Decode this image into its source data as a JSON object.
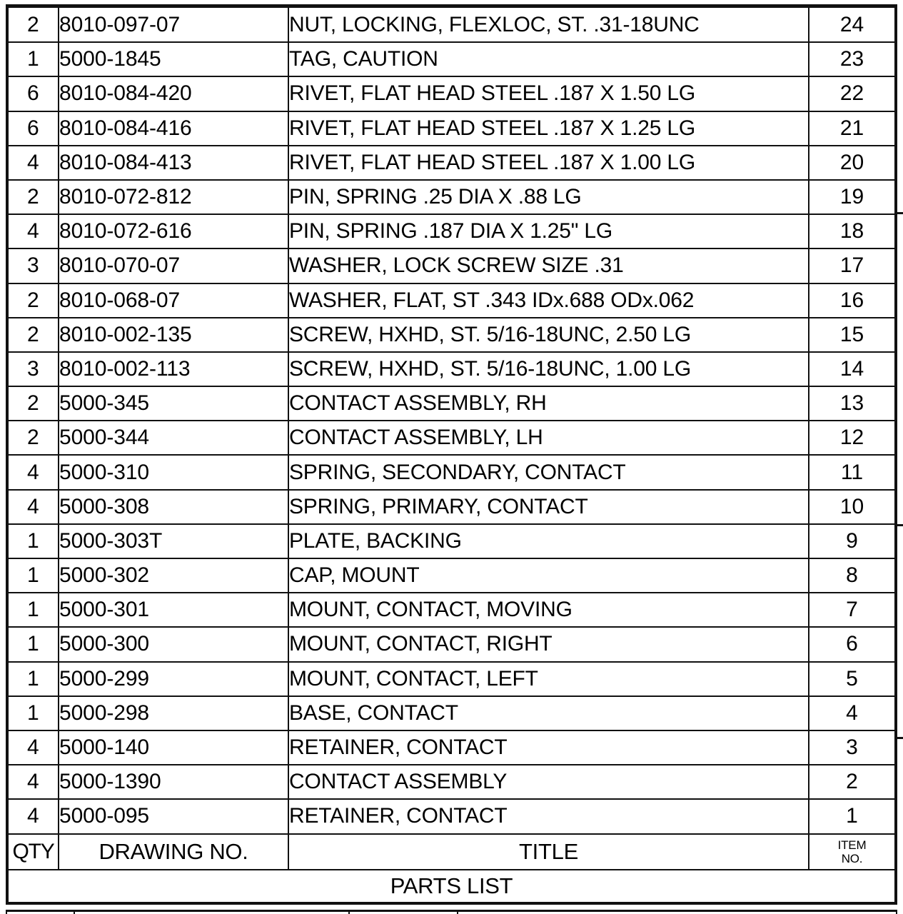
{
  "document": {
    "type": "engineering-drawing-parts-list",
    "banner_label": "PARTS LIST"
  },
  "table": {
    "columns": [
      {
        "key": "qty",
        "label": "QTY"
      },
      {
        "key": "dwg",
        "label": "DRAWING NO."
      },
      {
        "key": "title",
        "label": "TITLE"
      },
      {
        "key": "item",
        "label_line1": "ITEM",
        "label_line2": "NO."
      }
    ],
    "rows": [
      {
        "qty": "2",
        "dwg": "8010-097-07",
        "title": "NUT, LOCKING, FLEXLOC, ST. .31-18UNC",
        "item": "24"
      },
      {
        "qty": "1",
        "dwg": "5000-1845",
        "title": "TAG, CAUTION",
        "item": "23"
      },
      {
        "qty": "6",
        "dwg": "8010-084-420",
        "title": "RIVET, FLAT HEAD STEEL .187 X 1.50 LG",
        "item": "22"
      },
      {
        "qty": "6",
        "dwg": "8010-084-416",
        "title": "RIVET, FLAT HEAD STEEL .187 X 1.25 LG",
        "item": "21"
      },
      {
        "qty": "4",
        "dwg": "8010-084-413",
        "title": "RIVET, FLAT HEAD STEEL .187 X 1.00 LG",
        "item": "20"
      },
      {
        "qty": "2",
        "dwg": "8010-072-812",
        "title": "PIN, SPRING .25 DIA X .88 LG",
        "item": "19"
      },
      {
        "qty": "4",
        "dwg": "8010-072-616",
        "title": "PIN, SPRING .187 DIA X 1.25\" LG",
        "item": "18"
      },
      {
        "qty": "3",
        "dwg": "8010-070-07",
        "title": "WASHER, LOCK SCREW SIZE .31",
        "item": "17"
      },
      {
        "qty": "2",
        "dwg": "8010-068-07",
        "title": "WASHER, FLAT, ST .343 IDx.688 ODx.062",
        "item": "16"
      },
      {
        "qty": "2",
        "dwg": "8010-002-135",
        "title": "SCREW, HXHD, ST. 5/16-18UNC, 2.50 LG",
        "item": "15"
      },
      {
        "qty": "3",
        "dwg": "8010-002-113",
        "title": "SCREW, HXHD, ST. 5/16-18UNC, 1.00 LG",
        "item": "14"
      },
      {
        "qty": "2",
        "dwg": "5000-345",
        "title": "CONTACT ASSEMBLY, RH",
        "item": "13"
      },
      {
        "qty": "2",
        "dwg": "5000-344",
        "title": "CONTACT ASSEMBLY, LH",
        "item": "12"
      },
      {
        "qty": "4",
        "dwg": "5000-310",
        "title": "SPRING, SECONDARY, CONTACT",
        "item": "11"
      },
      {
        "qty": "4",
        "dwg": "5000-308",
        "title": "SPRING, PRIMARY, CONTACT",
        "item": "10"
      },
      {
        "qty": "1",
        "dwg": "5000-303T",
        "title": "PLATE, BACKING",
        "item": "9"
      },
      {
        "qty": "1",
        "dwg": "5000-302",
        "title": "CAP, MOUNT",
        "item": "8"
      },
      {
        "qty": "1",
        "dwg": "5000-301",
        "title": "MOUNT, CONTACT, MOVING",
        "item": "7"
      },
      {
        "qty": "1",
        "dwg": "5000-300",
        "title": "MOUNT, CONTACT, RIGHT",
        "item": "6"
      },
      {
        "qty": "1",
        "dwg": "5000-299",
        "title": "MOUNT, CONTACT, LEFT",
        "item": "5"
      },
      {
        "qty": "1",
        "dwg": "5000-298",
        "title": "BASE, CONTACT",
        "item": "4"
      },
      {
        "qty": "4",
        "dwg": "5000-140",
        "title": "RETAINER, CONTACT",
        "item": "3"
      },
      {
        "qty": "4",
        "dwg": "5000-1390",
        "title": "CONTACT ASSEMBLY",
        "item": "2"
      },
      {
        "qty": "4",
        "dwg": "5000-095",
        "title": "RETAINER, CONTACT",
        "item": "1"
      }
    ]
  },
  "colors": {
    "ink": "#111111",
    "paper": "#ffffff"
  }
}
